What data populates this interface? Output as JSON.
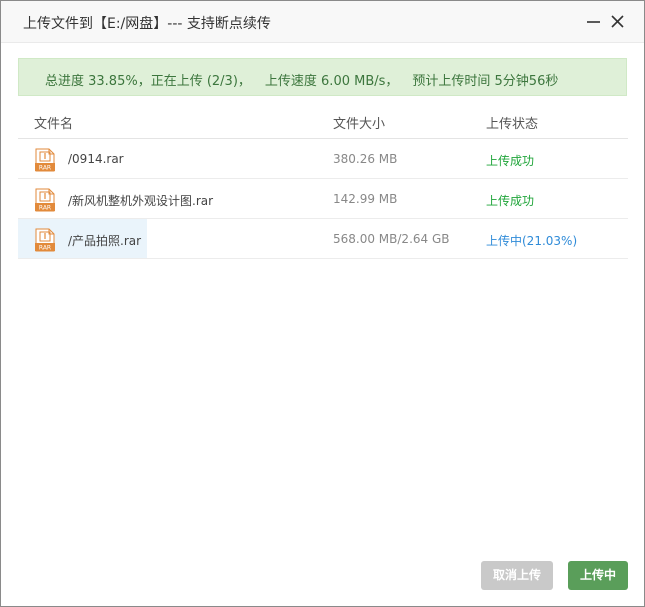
{
  "dialog": {
    "title": "上传文件到【E:/网盘】--- 支持断点续传"
  },
  "progress": {
    "overall": "总进度 33.85%，正在上传 (2/3)，",
    "speed": "上传速度 6.00 MB/s，",
    "eta": "预计上传时间 5分钟56秒"
  },
  "table": {
    "headers": [
      "文件名",
      "文件大小",
      "上传状态"
    ],
    "rows": [
      {
        "icon": "rar-file-icon",
        "name": "/0914.rar",
        "size": "380.26 MB",
        "status": "上传成功",
        "state": "success"
      },
      {
        "icon": "rar-file-icon",
        "name": "/新风机整机外观设计图.rar",
        "size": "142.99 MB",
        "status": "上传成功",
        "state": "success"
      },
      {
        "icon": "rar-file-icon",
        "name": "/产品拍照.rar",
        "size": "568.00 MB/2.64 GB",
        "status": "上传中(21.03%)",
        "state": "uploading"
      }
    ]
  },
  "buttons": {
    "cancel": "取消上传",
    "upload": "上传中"
  },
  "colors": {
    "success": "#20a53a",
    "uploading": "#2f8bd8",
    "banner_bg": "#dff0d8",
    "primary_button": "#5a9e5a",
    "disabled_button": "#c9c9c9"
  },
  "icons": {
    "minimize": "minimize-icon",
    "close": "close-icon",
    "file": "rar-file-icon"
  }
}
